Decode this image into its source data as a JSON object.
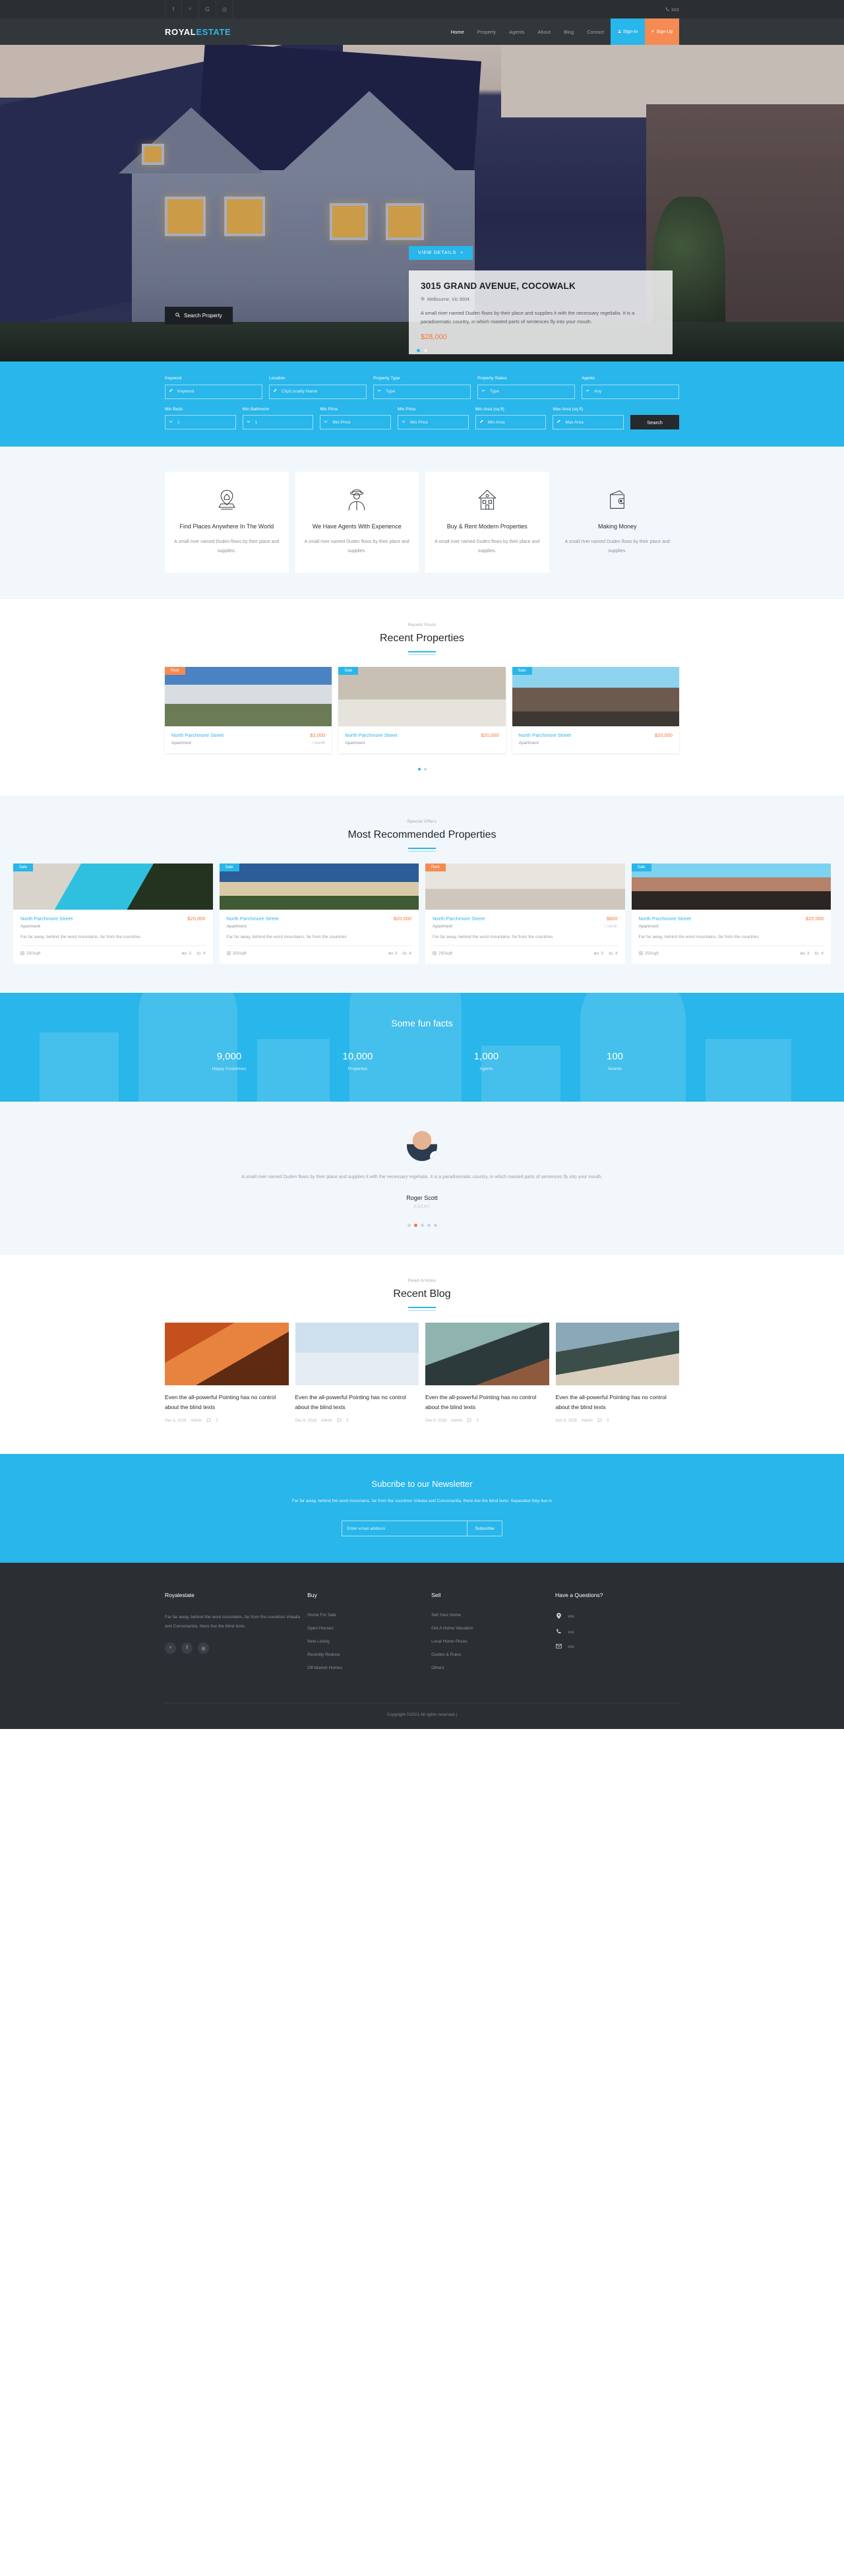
{
  "topbar": {
    "social": [
      {
        "name": "facebook-icon",
        "glyph": "f"
      },
      {
        "name": "twitter-icon",
        "glyph": "ᵛ"
      },
      {
        "name": "google-icon",
        "glyph": "G"
      },
      {
        "name": "instagram-icon",
        "glyph": "◎"
      }
    ],
    "phone": "xxx",
    "phone_icon": "phone-icon"
  },
  "nav": {
    "brand_prefix": "ROYAL",
    "brand_suffix": "ESTATE",
    "items": [
      {
        "label": "Home",
        "active": true
      },
      {
        "label": "Property",
        "active": false
      },
      {
        "label": "Agents",
        "active": false
      },
      {
        "label": "About",
        "active": false
      },
      {
        "label": "Blog",
        "active": false
      },
      {
        "label": "Contact",
        "active": false
      }
    ],
    "signin": "Sign-In",
    "signup": "Sign-Up"
  },
  "hero": {
    "search_button": "Search Property",
    "view_details": "VIEW DETAILS",
    "title": "3015 GRAND AVENUE, COCOWALK",
    "location": "Melbourne, Vic 3004",
    "description": "A small river named Duden flows by their place and supplies it with the necessary regelialia. It is a paradisematic country, in which roasted parts of sentences fly into your mouth.",
    "price": "$28,000"
  },
  "search_panel": {
    "row1": [
      {
        "label": "Keyword",
        "placeholder": "Keyword",
        "icon": "pencil-icon",
        "type": "text"
      },
      {
        "label": "Location",
        "placeholder": "City/Locality Name",
        "icon": "pencil-icon",
        "type": "text"
      },
      {
        "label": "Property Type",
        "placeholder": "Type",
        "icon": "chevron-down-icon",
        "type": "select"
      },
      {
        "label": "Property Status",
        "placeholder": "Type",
        "icon": "chevron-down-icon",
        "type": "select"
      },
      {
        "label": "Agents",
        "placeholder": "Any",
        "icon": "chevron-down-icon",
        "type": "select"
      }
    ],
    "row2": [
      {
        "label": "Min Beds",
        "placeholder": "1",
        "icon": "chevron-down-icon",
        "type": "select"
      },
      {
        "label": "Min Bathroom",
        "placeholder": "1",
        "icon": "chevron-down-icon",
        "type": "select"
      },
      {
        "label": "Min Price",
        "placeholder": "Min Price",
        "icon": "chevron-down-icon",
        "type": "select"
      },
      {
        "label": "Min Price",
        "placeholder": "Min Price",
        "icon": "chevron-down-icon",
        "type": "select"
      },
      {
        "label": "Min Area (sq ft)",
        "placeholder": "Min Area",
        "icon": "pencil-icon",
        "type": "text"
      },
      {
        "label": "Max Area (sq ft)",
        "placeholder": "Max Area",
        "icon": "pencil-icon",
        "type": "text"
      }
    ],
    "search_button": "Search"
  },
  "features": [
    {
      "icon": "map-pin-home-icon",
      "title": "Find Places Anywhere In The World",
      "text": "A small river named Duden flows by their place and supplies."
    },
    {
      "icon": "agent-person-icon",
      "title": "We Have Agents With Experience",
      "text": "A small river named Duden flows by their place and supplies."
    },
    {
      "icon": "house-icon",
      "title": "Buy & Rent Modern Properties",
      "text": "A small river named Duden flows by their place and supplies."
    },
    {
      "icon": "wallet-icon",
      "title": "Making Money",
      "text": "A small river named Duden flows by their place and supplies."
    }
  ],
  "recent": {
    "subtitle": "Recent Posts",
    "title": "Recent Properties",
    "cards": [
      {
        "badge": "Rent",
        "badge_type": "rent",
        "name": "North Parchmore Street",
        "price": "$2,000",
        "per": "/ month",
        "type": "Apartment"
      },
      {
        "badge": "Sale",
        "badge_type": "sale",
        "name": "North Parchmore Street",
        "price": "$20,000",
        "per": "",
        "type": "Apartment"
      },
      {
        "badge": "Sale",
        "badge_type": "sale",
        "name": "North Parchmore Street",
        "price": "$20,000",
        "per": "",
        "type": "Apartment"
      }
    ]
  },
  "recommended": {
    "subtitle": "Special Offers",
    "title": "Most Recommended Properties",
    "cards": [
      {
        "badge": "Sale",
        "badge_type": "sale",
        "name": "North Parchmore Street",
        "price": "$20,000",
        "per": "",
        "type": "Apartment",
        "desc": "Far far away, behind the word mountains, far from the countries",
        "area": "250sqft",
        "beds": "3",
        "baths": "4"
      },
      {
        "badge": "Sale",
        "badge_type": "sale",
        "name": "North Parchmore Street",
        "price": "$20,000",
        "per": "",
        "type": "Apartment",
        "desc": "Far far away, behind the word mountains, far from the countries",
        "area": "250sqft",
        "beds": "3",
        "baths": "4"
      },
      {
        "badge": "Rent",
        "badge_type": "rent",
        "name": "North Parchmore Street",
        "price": "$800",
        "per": "/ month",
        "type": "Apartment",
        "desc": "Far far away, behind the word mountains, far from the countries",
        "area": "250sqft",
        "beds": "3",
        "baths": "4"
      },
      {
        "badge": "Sale",
        "badge_type": "sale",
        "name": "North Parchmore Street",
        "price": "$20,000",
        "per": "",
        "type": "Apartment",
        "desc": "Far far away, behind the word mountains, far from the countries",
        "area": "250sqft",
        "beds": "3",
        "baths": "4"
      }
    ]
  },
  "funfacts": {
    "title": "Some fun facts",
    "stats": [
      {
        "number": "9,000",
        "label": "Happy Customers"
      },
      {
        "number": "10,000",
        "label": "Properties"
      },
      {
        "number": "1,000",
        "label": "Agents"
      },
      {
        "number": "100",
        "label": "Awards"
      }
    ]
  },
  "testimonial": {
    "text": "A small river named Duden flows by their place and supplies it with the necessary regelialia. It is a paradisematic country, in which roasted parts of sentences fly into your mouth.",
    "name": "Roger Scott",
    "role": "AGENT",
    "dots": 5,
    "active_dot": 1
  },
  "blog": {
    "subtitle": "Read Articles",
    "title": "Recent Blog",
    "posts": [
      {
        "title": "Even the all-powerful Pointing has no control about the blind texts",
        "date": "Dec 6, 2018",
        "author": "Admin",
        "comments": "3"
      },
      {
        "title": "Even the all-powerful Pointing has no control about the blind texts",
        "date": "Dec 6, 2018",
        "author": "Admin",
        "comments": "3"
      },
      {
        "title": "Even the all-powerful Pointing has no control about the blind texts",
        "date": "Dec 6, 2018",
        "author": "Admin",
        "comments": "3"
      },
      {
        "title": "Even the all-powerful Pointing has no control about the blind texts",
        "date": "Dec 6, 2018",
        "author": "Admin",
        "comments": "3"
      }
    ]
  },
  "newsletter": {
    "title": "Subcribe to our Newsletter",
    "text": "Far far away, behind the word mountains, far from the countries Vokalia and Consonantia, there live the blind texts. Separated they live in",
    "placeholder": "Enter email address",
    "button": "Subscribe"
  },
  "footer": {
    "brand_title": "Royalestate",
    "brand_text": "Far far away, behind the word mountains, far from the countries Vokalia and Consonantia, there live the blind texts.",
    "social": [
      {
        "name": "twitter-icon",
        "glyph": "ᵛ"
      },
      {
        "name": "facebook-icon",
        "glyph": "f"
      },
      {
        "name": "instagram-icon",
        "glyph": "◎"
      }
    ],
    "buy_title": "Buy",
    "buy_links": [
      "Home For Sale",
      "Open Houses",
      "New Listing",
      "Recently Reduce",
      "Off-Market Homes"
    ],
    "sell_title": "Sell",
    "sell_links": [
      "Sell Your Home",
      "Get A Home Valuation",
      "Local Home Prices",
      "Guides & Rules",
      "Others"
    ],
    "contact_title": "Have a Questions?",
    "contact": [
      {
        "icon": "location-pin-icon",
        "value": "xxx"
      },
      {
        "icon": "phone-icon",
        "value": "xxx"
      },
      {
        "icon": "mail-icon",
        "value": "xxx"
      }
    ],
    "copyright": "Copyright ©2021 All rights reserved |"
  },
  "colors": {
    "accent": "#29b6ea",
    "orange": "#f58a52",
    "price": "#f5763a",
    "dark": "#2b2f33",
    "nav_dark": "#32373c",
    "light_bg": "#f2f7fb"
  }
}
